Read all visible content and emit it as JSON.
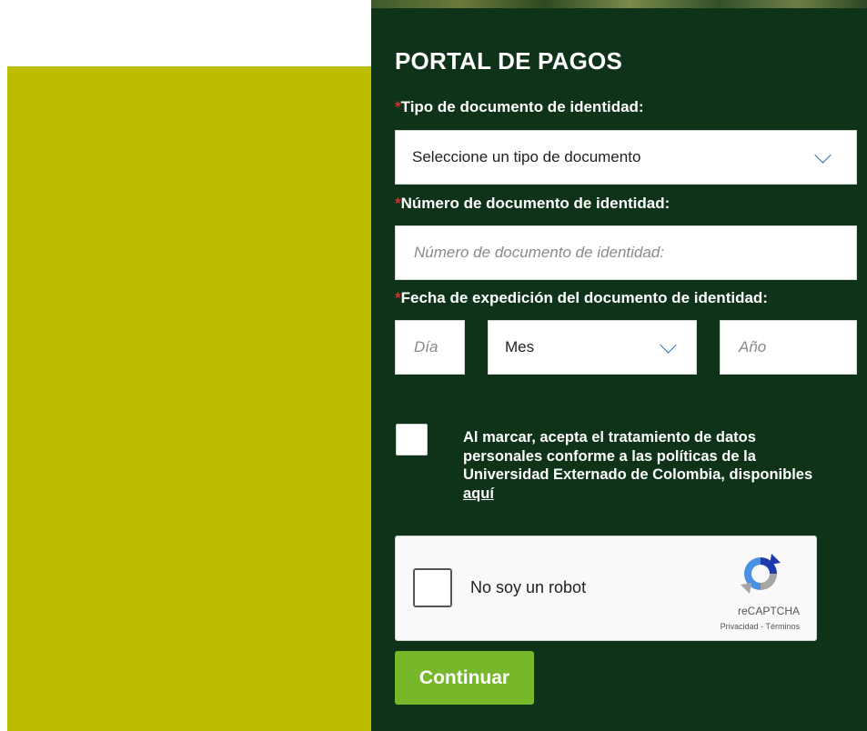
{
  "form": {
    "title": "PORTAL DE PAGOS",
    "required_mark": "*",
    "doc_type_label": "Tipo de documento de identidad:",
    "doc_type_selected": "Seleccione un tipo de documento",
    "doc_number_label": "Número de documento de identidad:",
    "doc_number_placeholder": "Número de documento de identidad:",
    "doc_number_value": "",
    "issue_date_label": "Fecha de expedición del documento de identidad:",
    "day_placeholder": "Día",
    "month_selected": "Mes",
    "year_placeholder": "Año",
    "consent_text": "Al marcar, acepta el tratamiento de datos personales conforme a las políticas de la Universidad Externado de Colombia, disponibles",
    "consent_link": "aquí",
    "consent_checked": false,
    "continue_label": "Continuar"
  },
  "captcha": {
    "label": "No soy un robot",
    "brand": "reCAPTCHA",
    "privacy_link": "Privacidad",
    "separator": " - ",
    "terms_link": "Términos",
    "checked": false
  },
  "colors": {
    "panel_background": "#0f3319",
    "olive_block": "#bdbd00",
    "continue_button": "#76b82a",
    "required_mark": "#d22f2f",
    "chevron": "#2a6fb4"
  },
  "icons": {
    "select_arrow": "chevron-down-icon",
    "recaptcha": "recaptcha-logo-icon"
  }
}
